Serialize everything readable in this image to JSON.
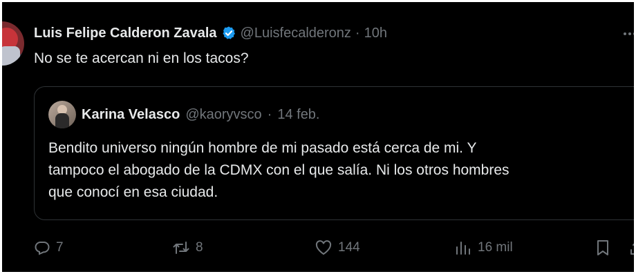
{
  "tweet": {
    "author_name": "Luis Felipe Calderon Zavala",
    "handle": "@Luisfecalderonz",
    "separator": "·",
    "time": "10h",
    "text": "No se te acercan ni en los tacos?"
  },
  "quote": {
    "author_name": "Karina Velasco",
    "handle": "@kaoryvsco",
    "separator": "·",
    "time": "14 feb.",
    "lines": [
      "Bendito universo ningún hombre de mi pasado está cerca de mi. Y",
      "tampoco el abogado de la CDMX con el que salía. Ni los otros hombres",
      "que conocí en esa ciudad."
    ]
  },
  "actions": {
    "replies": "7",
    "reposts": "8",
    "likes": "144",
    "views": "16 mil"
  },
  "icons": {
    "verified": "verified-badge-icon",
    "more": "more-options-icon",
    "reply": "reply-icon",
    "repost": "repost-icon",
    "like": "heart-icon",
    "views": "views-chart-icon",
    "bookmark": "bookmark-icon",
    "share": "share-icon"
  },
  "colors": {
    "background": "#000000",
    "text": "#e7e9ea",
    "muted": "#71767b",
    "border": "#2f3336",
    "verified": "#1d9bf0"
  }
}
